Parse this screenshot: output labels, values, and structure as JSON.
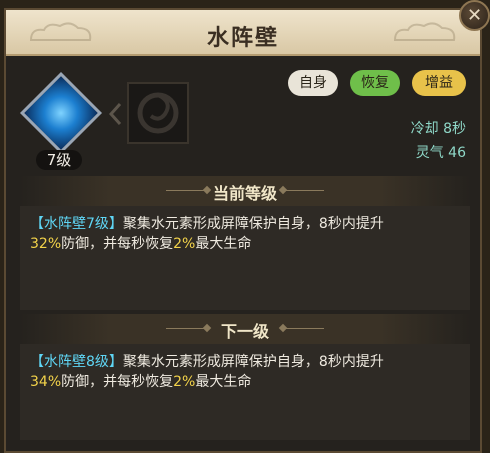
{
  "window": {
    "title": "水阵壁",
    "close_label": "✕"
  },
  "skill": {
    "level_badge": "7级"
  },
  "tags": [
    {
      "label": "自身",
      "color": "#e9e4d8"
    },
    {
      "label": "恢复",
      "color": "#6fbf4a"
    },
    {
      "label": "增益",
      "color": "#e8c24a"
    }
  ],
  "stats": {
    "cooldown": "冷却 8秒",
    "spirit": "灵气 46"
  },
  "current": {
    "heading": "当前等级",
    "bracket_open": "【",
    "skill_name": "水阵壁7级",
    "bracket_close": "】",
    "text_a": "聚集水元素形成屏障保护自身，8秒内提升",
    "pct1": "32%",
    "text_b": "防御，并每秒恢复",
    "pct2": "2%",
    "text_c": "最大生命"
  },
  "next": {
    "heading": "下一级",
    "bracket_open": "【",
    "skill_name": "水阵壁8级",
    "bracket_close": "】",
    "text_a": "聚集水元素形成屏障保护自身，8秒内提升",
    "pct1": "34%",
    "text_b": "防御，并每秒恢复",
    "pct2": "2%",
    "text_c": "最大生命"
  }
}
